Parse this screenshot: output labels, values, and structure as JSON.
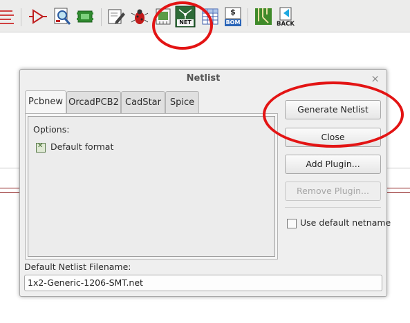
{
  "toolbar": {
    "net_caption": "NET",
    "bom_caption": "BOM",
    "back_caption": "BACK",
    "dollar_glyph": "$"
  },
  "dialog": {
    "title": "Netlist",
    "close_glyph": "×",
    "tabs": [
      {
        "label": "Pcbnew",
        "active": true
      },
      {
        "label": "OrcadPCB2",
        "active": false
      },
      {
        "label": "CadStar",
        "active": false
      },
      {
        "label": "Spice",
        "active": false
      }
    ],
    "options_label": "Options:",
    "default_format_label": "Default format",
    "default_format_checked": true,
    "buttons": {
      "generate": "Generate Netlist",
      "close": "Close",
      "add_plugin": "Add Plugin...",
      "remove_plugin": "Remove Plugin..."
    },
    "use_default_netname_label": "Use default netname",
    "use_default_netname_checked": false,
    "filename_label": "Default Netlist Filename:",
    "filename_value": "1x2-Generic-1206-SMT.net"
  },
  "colors": {
    "annotation": "#e31414",
    "schematic_line": "#8b1a1a"
  }
}
